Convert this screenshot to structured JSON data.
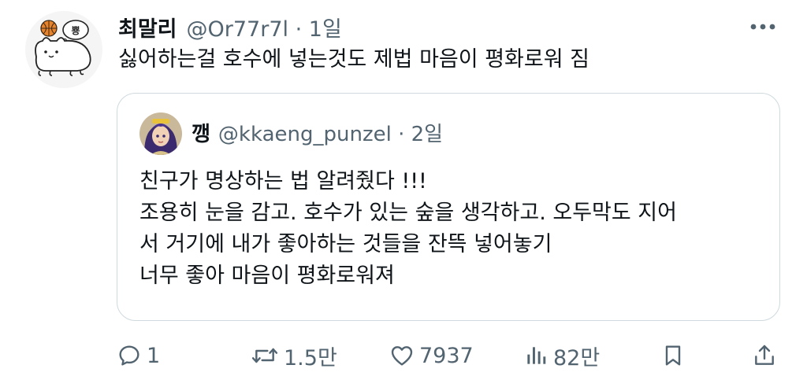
{
  "tweet": {
    "display_name": "최말리",
    "handle_meta": "@Or77r7l · 1일",
    "text": "싫어하는걸 호수에 넣는것도 제법 마음이 평화로워 짐",
    "avatar_icon": "cat-with-basketball-avatar",
    "avatar_thought": "뿅"
  },
  "quote": {
    "display_name": "깽",
    "handle_meta": "@kkaeng_punzel · 2일",
    "lines": [
      "친구가 명상하는 법 알려줬다 !!!",
      "조용히 눈을 감고. 호수가 있는 숲을 생각하고. 오두막도 지어",
      "서 거기에 내가 좋아하는 것들을 잔뜩 넣어놓기",
      "너무 좋아 마음이 평화로워져"
    ],
    "avatar_icon": "anime-character-avatar"
  },
  "actions": {
    "reply_count": "1",
    "retweet_count": "1.5만",
    "like_count": "7937",
    "view_count": "82만"
  },
  "colors": {
    "text_primary": "#0f1419",
    "text_secondary": "#536471",
    "border": "#cfd9de",
    "basketball": "#e8832a"
  }
}
